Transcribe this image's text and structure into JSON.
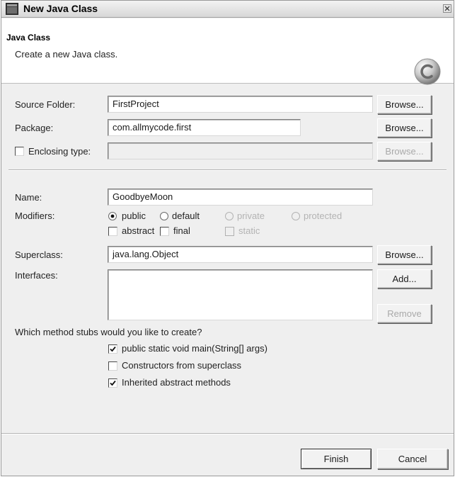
{
  "window": {
    "title": "New Java Class"
  },
  "banner": {
    "title": "Java Class",
    "description": "Create a new Java class."
  },
  "form": {
    "source_folder": {
      "label": "Source Folder:",
      "value": "FirstProject",
      "button": "Browse..."
    },
    "package": {
      "label": "Package:",
      "value": "com.allmycode.first",
      "button": "Browse..."
    },
    "enclosing_type": {
      "label": "Enclosing type:",
      "value": "",
      "button": "Browse...",
      "checked": false
    },
    "name": {
      "label": "Name:",
      "value": "GoodbyeMoon"
    },
    "modifiers": {
      "label": "Modifiers:",
      "access": [
        {
          "label": "public",
          "selected": true,
          "enabled": true
        },
        {
          "label": "default",
          "selected": false,
          "enabled": true
        },
        {
          "label": "private",
          "selected": false,
          "enabled": false
        },
        {
          "label": "protected",
          "selected": false,
          "enabled": false
        }
      ],
      "flags": [
        {
          "label": "abstract",
          "checked": false,
          "enabled": true
        },
        {
          "label": "final",
          "checked": false,
          "enabled": true
        },
        {
          "label": "static",
          "checked": false,
          "enabled": false
        }
      ]
    },
    "superclass": {
      "label": "Superclass:",
      "value": "java.lang.Object",
      "button": "Browse..."
    },
    "interfaces": {
      "label": "Interfaces:",
      "add_button": "Add...",
      "remove_button": "Remove"
    }
  },
  "stubs": {
    "question": "Which method stubs would you like to create?",
    "options": [
      {
        "label": "public static void main(String[] args)",
        "checked": true
      },
      {
        "label": "Constructors from superclass",
        "checked": false
      },
      {
        "label": "Inherited abstract methods",
        "checked": true
      }
    ]
  },
  "footer": {
    "finish": "Finish",
    "cancel": "Cancel"
  }
}
